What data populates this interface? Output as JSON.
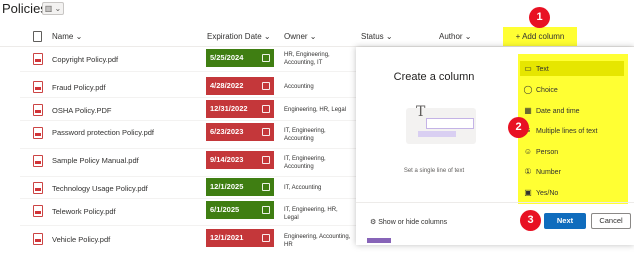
{
  "page": {
    "title": "Policies",
    "view_icon": "library-view-icon"
  },
  "columns": {
    "name": "Name",
    "expiration": "Expiration Date",
    "owner": "Owner",
    "status": "Status",
    "author": "Author",
    "add_column": "+ Add column"
  },
  "rows": [
    {
      "name": "Copyright Policy.pdf",
      "expiration": "5/25/2024",
      "exp_color": "green",
      "owner": "HR, Engineering, Accounting, IT"
    },
    {
      "name": "Fraud Policy.pdf",
      "expiration": "4/28/2022",
      "exp_color": "red",
      "owner": "Accounting"
    },
    {
      "name": "OSHA Policy.PDF",
      "expiration": "12/31/2022",
      "exp_color": "red",
      "owner": "Engineering, HR, Legal"
    },
    {
      "name": "Password protection Policy.pdf",
      "expiration": "6/23/2023",
      "exp_color": "red",
      "owner": "IT, Engineering, Accounting"
    },
    {
      "name": "Sample Policy Manual.pdf",
      "expiration": "9/14/2023",
      "exp_color": "red",
      "owner": "IT, Engineering, Accounting"
    },
    {
      "name": "Technology Usage Policy.pdf",
      "expiration": "12/1/2025",
      "exp_color": "green",
      "owner": "IT, Accounting"
    },
    {
      "name": "Telework Policy.pdf",
      "expiration": "6/1/2025",
      "exp_color": "green",
      "owner": "IT, Engineering, HR, Legal"
    },
    {
      "name": "Vehicle Policy.pdf",
      "expiration": "12/1/2021",
      "exp_color": "red",
      "owner": "Engineering, Accounting, HR"
    }
  ],
  "panel": {
    "title": "Create a column",
    "preview_caption": "Set a single line of text",
    "types": [
      "Text",
      "Choice",
      "Date and time",
      "Multiple lines of text",
      "Person",
      "Number",
      "Yes/No"
    ],
    "selected_type": "Text",
    "show_hide": "Show or hide columns",
    "next": "Next",
    "cancel": "Cancel"
  },
  "badges": [
    "1",
    "2",
    "3"
  ],
  "colors": {
    "highlight": "#ffff33",
    "expired": "#c4373a",
    "valid": "#3f7e12",
    "primary": "#0f6cbd",
    "badge": "#e81123"
  }
}
